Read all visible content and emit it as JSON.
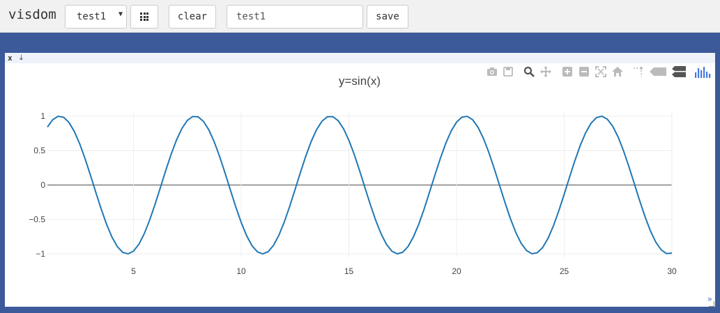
{
  "app": {
    "brand": "visdom"
  },
  "toolbar": {
    "env_selected": "test1",
    "clear_label": "clear",
    "env_name_value": "test1",
    "save_label": "save"
  },
  "pane": {
    "close_label": "x",
    "download_label": "⤓",
    "resize_label": "»"
  },
  "modebar_icons": [
    "camera-icon",
    "save-icon",
    "zoom-icon",
    "pan-icon",
    "zoom-in-icon",
    "zoom-out-icon",
    "autoscale-icon",
    "home-icon",
    "spike-lines-icon",
    "hover-closest-icon",
    "hover-compare-icon",
    "plotly-logo-icon"
  ],
  "colors": {
    "line": "#1f77b4",
    "accent": "#3c5a99"
  },
  "chart_data": {
    "type": "line",
    "title": "y=sin(x)",
    "xlabel": "",
    "ylabel": "",
    "xlim": [
      1,
      30
    ],
    "ylim": [
      -1.05,
      1.05
    ],
    "xticks": [
      5,
      10,
      15,
      20,
      25,
      30
    ],
    "yticks": [
      1,
      0.5,
      0,
      -0.5,
      -1
    ],
    "ytick_labels": [
      "1",
      "0.5",
      "0",
      "−0.5",
      "−1"
    ],
    "grid": true,
    "series": [
      {
        "function": "sin",
        "x_start": 1,
        "x_end": 30,
        "x_step": 0.25
      }
    ]
  }
}
